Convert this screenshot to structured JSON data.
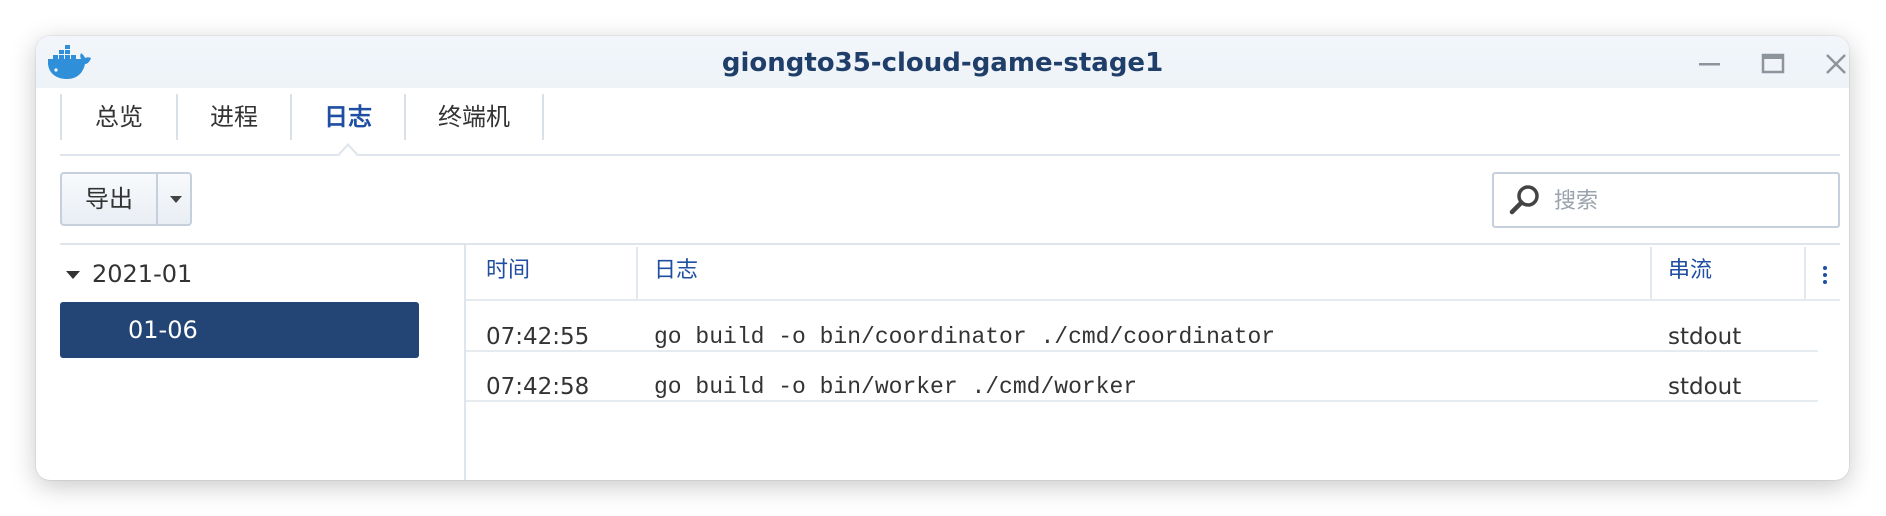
{
  "window": {
    "title": "giongto35-cloud-game-stage1",
    "app_icon": "docker-whale-icon",
    "controls": [
      "minimize-icon",
      "maximize-icon",
      "close-icon"
    ]
  },
  "tabs": [
    {
      "label": "总览",
      "active": false
    },
    {
      "label": "进程",
      "active": false
    },
    {
      "label": "日志",
      "active": true
    },
    {
      "label": "终端机",
      "active": false
    }
  ],
  "toolbar": {
    "export_label": "导出",
    "export_menu_icon": "caret-down-icon"
  },
  "search": {
    "placeholder": "搜索",
    "value": "",
    "icon": "search-icon"
  },
  "date_tree": {
    "group": "2021-01",
    "expanded": true,
    "selected_day": "01-06"
  },
  "log_table": {
    "columns": [
      "时间",
      "日志",
      "串流"
    ],
    "rows": [
      {
        "time": "07:42:55",
        "message": "go build -o bin/coordinator ./cmd/coordinator",
        "stream": "stdout"
      },
      {
        "time": "07:42:58",
        "message": "go build -o bin/worker ./cmd/worker",
        "stream": "stdout"
      }
    ],
    "column_menu_icon": "kebab-menu-icon"
  },
  "colors": {
    "accent": "#1f4ea3",
    "selection": "#234576",
    "title": "#1f3e69"
  }
}
